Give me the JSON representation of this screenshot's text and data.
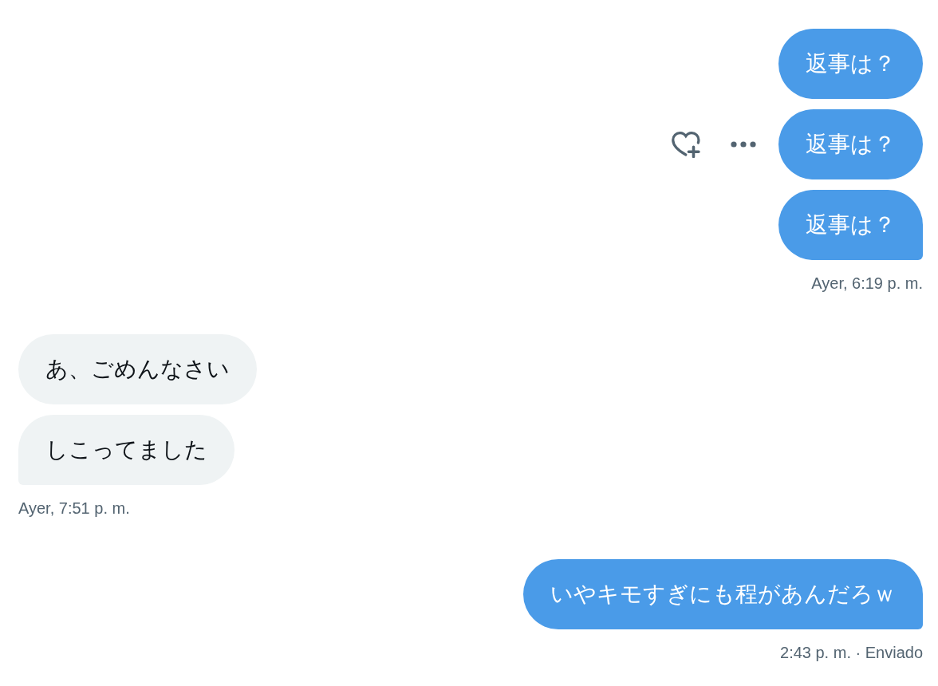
{
  "conversation": [
    {
      "kind": "sent",
      "messages": [
        {
          "text": "返事は？",
          "hovered": false
        },
        {
          "text": "返事は？",
          "hovered": true
        },
        {
          "text": "返事は？",
          "hovered": false
        }
      ],
      "timestamp": "Ayer, 6:19 p. m."
    },
    {
      "kind": "received",
      "messages": [
        {
          "text": "あ、ごめんなさい",
          "hovered": false
        },
        {
          "text": "しこってました",
          "hovered": false
        }
      ],
      "timestamp": "Ayer, 7:51 p. m."
    },
    {
      "kind": "sent",
      "messages": [
        {
          "text": "いやキモすぎにも程があんだろｗ",
          "hovered": false
        }
      ],
      "timestamp": "2:43 p. m. · Enviado"
    }
  ]
}
